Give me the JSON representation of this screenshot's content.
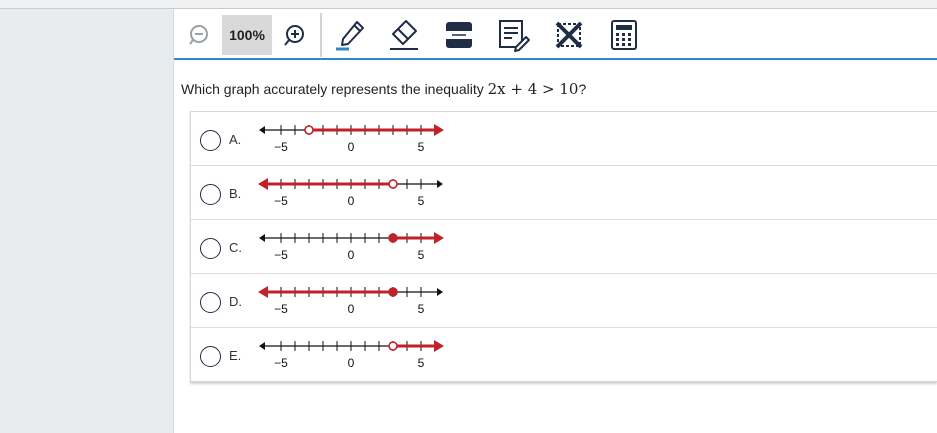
{
  "toolbar": {
    "zoom_level": "100%",
    "icons": [
      "zoom-out-icon",
      "zoom-in-icon",
      "highlighter-icon",
      "eraser-icon",
      "line-reader-icon",
      "notepad-icon",
      "answer-eliminator-icon",
      "calculator-icon"
    ]
  },
  "question": {
    "prefix": "Which graph accurately represents the inequality ",
    "math": "2x + 4 > 10",
    "suffix": "?"
  },
  "number_line": {
    "tick_labels": [
      "−5",
      "0",
      "5"
    ],
    "min": -6,
    "max": 6
  },
  "choices": [
    {
      "letter": "A.",
      "boundary": -3,
      "closed": false,
      "direction": "right"
    },
    {
      "letter": "B.",
      "boundary": 3,
      "closed": false,
      "direction": "left"
    },
    {
      "letter": "C.",
      "boundary": 3,
      "closed": true,
      "direction": "right"
    },
    {
      "letter": "D.",
      "boundary": 3,
      "closed": true,
      "direction": "left"
    },
    {
      "letter": "E.",
      "boundary": 3,
      "closed": false,
      "direction": "right"
    }
  ],
  "colors": {
    "accent": "#2f86c9",
    "graph_red": "#c0222b",
    "radio_border": "#1f2d46"
  }
}
